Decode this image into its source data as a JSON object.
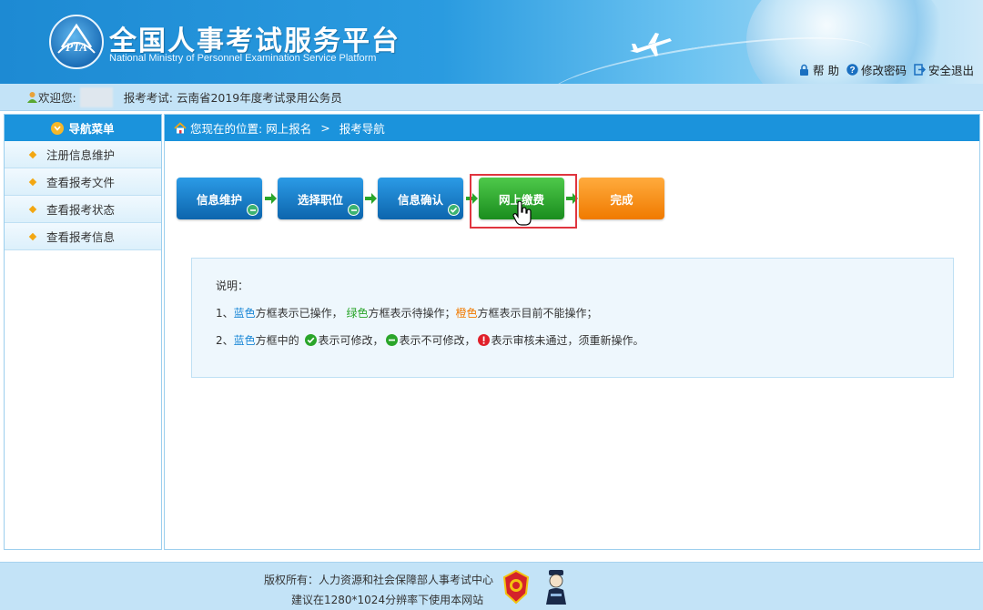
{
  "header": {
    "title": "全国人事考试服务平台",
    "subtitle": "National Ministry of Personnel Examination Service Platform",
    "logo_text": "PTA",
    "links": [
      {
        "label": "帮 助",
        "icon": "lock-icon"
      },
      {
        "label": "修改密码",
        "icon": "question-icon"
      },
      {
        "label": "安全退出",
        "icon": "exit-icon"
      }
    ]
  },
  "welcome": {
    "prefix": "欢迎您:",
    "exam_label": "报考考试:",
    "exam_name": "云南省2019年度考试录用公务员"
  },
  "sidebar": {
    "title": "导航菜单",
    "items": [
      {
        "label": "注册信息维护"
      },
      {
        "label": "查看报考文件"
      },
      {
        "label": "查看报考状态"
      },
      {
        "label": "查看报考信息"
      }
    ]
  },
  "breadcrumb": {
    "prefix": "您现在的位置:",
    "items": [
      "网上报名",
      "报考导航"
    ],
    "separator": ">"
  },
  "steps": [
    {
      "label": "信息维护",
      "color": "blue",
      "badge": "minus"
    },
    {
      "label": "选择职位",
      "color": "blue",
      "badge": "minus"
    },
    {
      "label": "信息确认",
      "color": "blue",
      "badge": "check"
    },
    {
      "label": "网上缴费",
      "color": "green",
      "badge": ""
    },
    {
      "label": "完成",
      "color": "orange",
      "badge": ""
    }
  ],
  "note": {
    "heading": "说明：",
    "line1": {
      "num": "1、",
      "blue": "蓝色",
      "t1": "方框表示已操作，",
      "green": "绿色",
      "t2": "方框表示待操作；",
      "orange": "橙色",
      "t3": "方框表示目前不能操作；"
    },
    "line2": {
      "num": "2、",
      "blue": "蓝色",
      "t1": "方框中的",
      "t2": "表示可修改，",
      "t3": "表示不可修改，",
      "t4": "表示审核未通过，须重新操作。"
    }
  },
  "footer": {
    "copyright": "版权所有：人力资源和社会保障部人事考试中心",
    "suggest": "建议在1280*1024分辨率下使用本网站"
  },
  "colors": {
    "header_blue": "#1d8ad3",
    "nav_blue": "#1b93dc",
    "step_blue": "#0d65ad",
    "step_green": "#1a8d1e",
    "step_orange": "#f07a00",
    "highlight_red": "#e0353f"
  }
}
